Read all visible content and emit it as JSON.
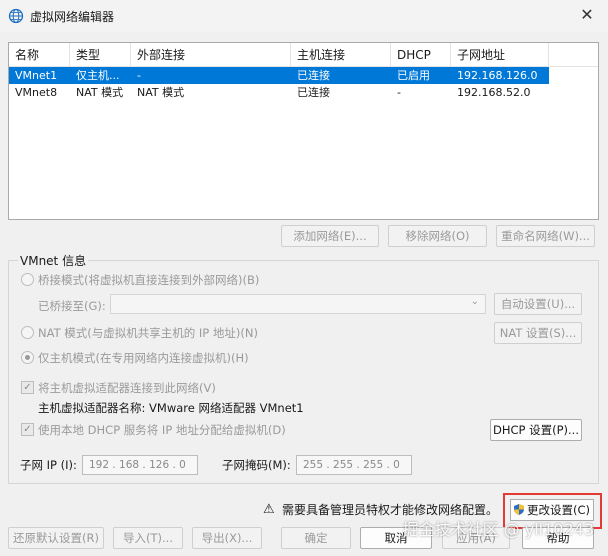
{
  "window": {
    "title": "虚拟网络编辑器",
    "close_glyph": "✕"
  },
  "table": {
    "headers": [
      "名称",
      "类型",
      "外部连接",
      "主机连接",
      "DHCP",
      "子网地址"
    ],
    "rows": [
      {
        "name": "VMnet1",
        "type": "仅主机...",
        "external": "-",
        "host": "已连接",
        "dhcp": "已启用",
        "subnet": "192.168.126.0",
        "selected": true
      },
      {
        "name": "VMnet8",
        "type": "NAT 模式",
        "external": "NAT 模式",
        "host": "已连接",
        "dhcp": "-",
        "subnet": "192.168.52.0",
        "selected": false
      }
    ]
  },
  "list_buttons": {
    "add": "添加网络(E)...",
    "remove": "移除网络(O)",
    "rename": "重命名网络(W)..."
  },
  "vmnet_info": {
    "label": "VMnet 信息",
    "bridge_radio": "桥接模式(将虚拟机直接连接到外部网络)(B)",
    "bridged_to_label": "已桥接至(G):",
    "bridged_to_value": "",
    "auto_settings": "自动设置(U)...",
    "nat_radio": "NAT 模式(与虚拟机共享主机的 IP 地址)(N)",
    "nat_settings": "NAT 设置(S)...",
    "host_only_radio": "仅主机模式(在专用网络内连接虚拟机)(H)",
    "connect_adapter": "将主机虚拟适配器连接到此网络(V)",
    "adapter_name_label": "主机虚拟适配器名称: VMware 网络适配器 VMnet1",
    "use_dhcp": "使用本地 DHCP 服务将 IP 地址分配给虚拟机(D)",
    "dhcp_settings": "DHCP 设置(P)...",
    "subnet_ip_label": "子网 IP (I):",
    "subnet_ip_value": "192 . 168 . 126 . 0",
    "subnet_mask_label": "子网掩码(M):",
    "subnet_mask_value": "255 . 255 . 255 . 0"
  },
  "notice": {
    "warning_glyph": "⚠",
    "text": "需要具备管理员特权才能修改网络配置。",
    "change_settings": "更改设置(C)"
  },
  "footer": {
    "restore": "还原默认设置(R)",
    "import": "导入(T)...",
    "export": "导出(X)...",
    "ok": "确定",
    "cancel": "取消",
    "apply": "应用(A)",
    "help": "帮助"
  },
  "watermark": "掘金技术社区 @ yll10243",
  "colors": {
    "selection": "#0078d7",
    "highlight_box": "#e53935",
    "window_bg": "#f0f0f0"
  }
}
